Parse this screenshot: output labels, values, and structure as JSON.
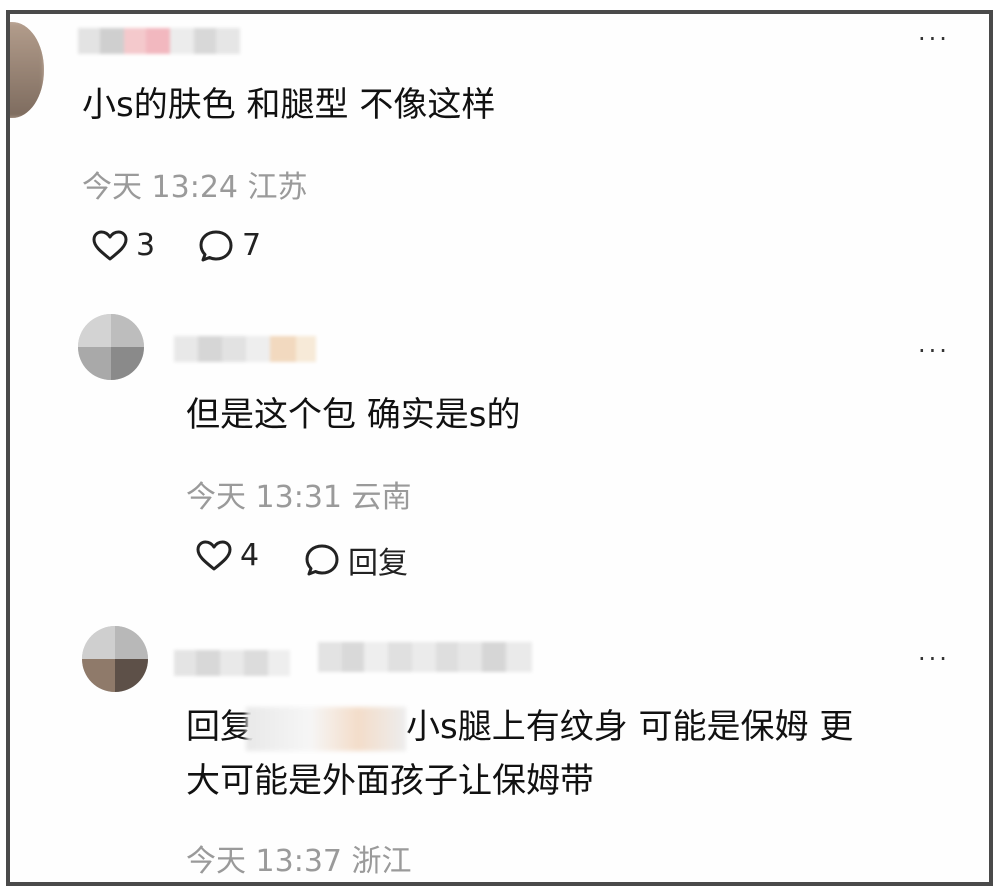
{
  "comments": [
    {
      "body": "小s的肤色 和腿型 不像这样",
      "time": "今天 13:24",
      "location": "江苏",
      "likes": "3",
      "replies": "7"
    },
    {
      "body": "但是这个包 确实是s的",
      "time": "今天 13:31",
      "location": "云南",
      "likes": "4",
      "reply_label": "回复"
    },
    {
      "reply_prefix": "回复",
      "body_line1": "小s腿上有纹身 可能是保姆 更",
      "body_line2": "大可能是外面孩子让保姆带",
      "time": "今天 13:37",
      "location": "浙江"
    }
  ],
  "more_glyph": "···",
  "icons": {
    "like": "heart-outline-icon",
    "comment": "speech-bubble-icon",
    "more": "more-dots-icon"
  },
  "colors": {
    "frame_border": "#4a4a4a",
    "meta_text": "#9a9a9a",
    "body_text": "#111111"
  }
}
